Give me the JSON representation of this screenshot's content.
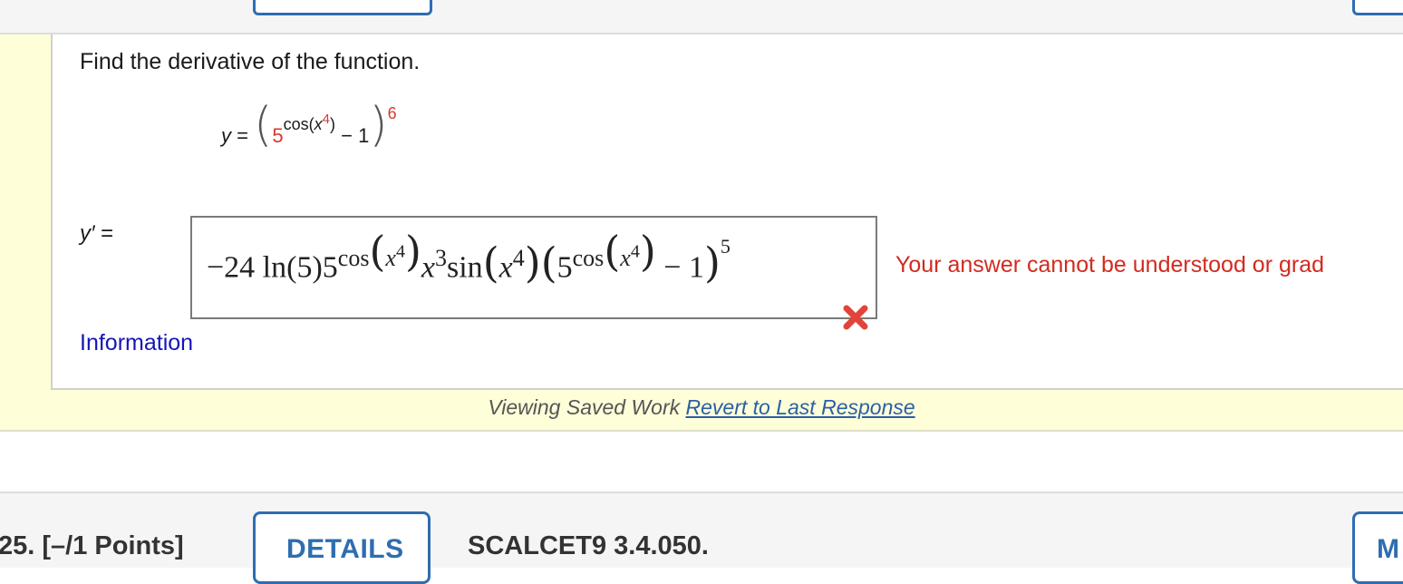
{
  "prompt": "Find the derivative of the function.",
  "function": {
    "lhs": "y",
    "eq": "=",
    "base": "5",
    "exp_fn": "cos(",
    "exp_var": "x",
    "exp_pow": "4",
    "exp_close": ")",
    "minus_one": "− 1",
    "outer_pow": "6"
  },
  "derivative_label": {
    "var": "y′",
    "eq": "="
  },
  "answer": {
    "coef": "−24 ln",
    "ln_arg": "(5)",
    "base": "5",
    "cos": "cos",
    "x": "x",
    "p4": "4",
    "x3_pow": "3",
    "sin": "sin",
    "minus_one": "− 1",
    "outer_pow": "5"
  },
  "error_message": "Your answer cannot be understood or grad",
  "info_link": "Information",
  "saved": {
    "text": "Viewing Saved Work",
    "revert": "Revert to Last Response"
  },
  "next_question": {
    "number": "25.  [–/1 Points]",
    "details": "DETAILS",
    "code": "SCALCET9 3.4.050.",
    "right_btn": "M"
  },
  "colors": {
    "accent": "#2f6db0",
    "error": "#d12b1f",
    "panel": "#fefed9",
    "link": "#1515b8"
  },
  "icons": {
    "wrong": "x-mark-icon"
  }
}
